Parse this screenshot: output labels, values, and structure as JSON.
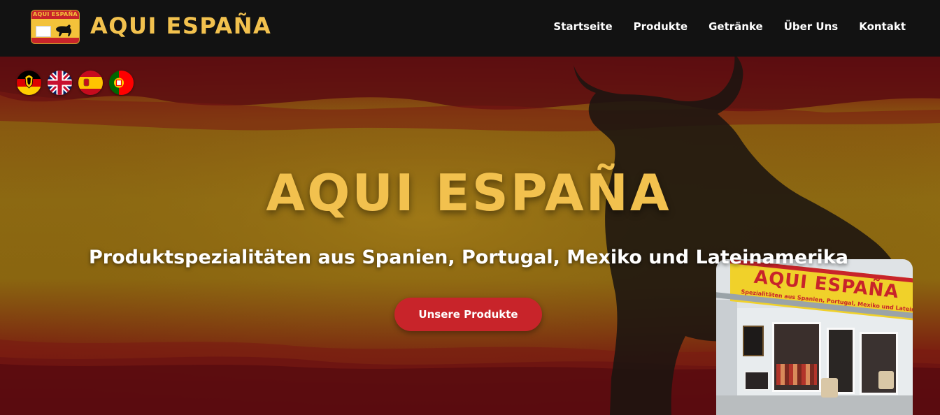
{
  "header": {
    "brand": "AQUI ESPAÑA",
    "logo_text": "AQUI ESPAÑA",
    "nav": [
      {
        "label": "Startseite"
      },
      {
        "label": "Produkte"
      },
      {
        "label": "Getränke"
      },
      {
        "label": "Über Uns"
      },
      {
        "label": "Kontakt"
      }
    ]
  },
  "languages": [
    {
      "code": "de",
      "icon": "germany-flag-icon"
    },
    {
      "code": "en",
      "icon": "uk-flag-icon"
    },
    {
      "code": "es",
      "icon": "spain-flag-icon"
    },
    {
      "code": "pt",
      "icon": "portugal-flag-icon"
    }
  ],
  "hero": {
    "title": "AQUI ESPAÑA",
    "subtitle": "Produktspezialitäten aus Spanien, Portugal, Mexiko und Lateinamerika",
    "cta_label": "Unsere Produkte"
  },
  "storefront": {
    "sign_title": "AQUI ESPAÑA",
    "sign_subtitle": "Spezialitäten aus Spanien, Portugal, Mexiko und Lateinamerika"
  },
  "colors": {
    "brand_yellow": "#f2c14e",
    "accent_red": "#c8242a",
    "header_bg": "#121212"
  }
}
